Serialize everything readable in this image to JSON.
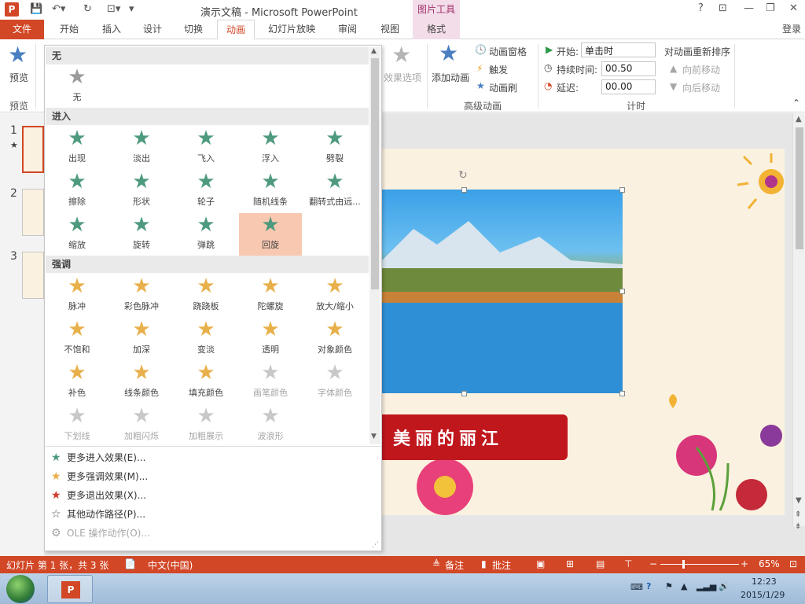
{
  "window": {
    "title": "演示文稿 - Microsoft PowerPoint",
    "context_tab_group": "图片工具",
    "help": "?",
    "login": "登录"
  },
  "tabs": [
    "文件",
    "开始",
    "插入",
    "设计",
    "切换",
    "动画",
    "幻灯片放映",
    "审阅",
    "视图",
    "格式"
  ],
  "active_tab": "动画",
  "ribbon": {
    "preview_label": "预览",
    "preview_group": "预览",
    "effect_options": "效果选项",
    "add_animation": "添加动画",
    "animation_pane": "动画窗格",
    "trigger": "触发",
    "animation_painter": "动画刷",
    "advanced_group": "高级动画",
    "start_label": "开始:",
    "start_value": "单击时",
    "duration_label": "持续时间:",
    "duration_value": "00.50",
    "delay_label": "延迟:",
    "delay_value": "00.00",
    "timing_group": "计时",
    "reorder_title": "对动画重新排序",
    "move_earlier": "向前移动",
    "move_later": "向后移动"
  },
  "gallery": {
    "sections": {
      "none": "无",
      "entrance": "进入",
      "emphasis": "强调"
    },
    "none_items": [
      "无"
    ],
    "entrance_items": [
      "出现",
      "淡出",
      "飞入",
      "浮入",
      "劈裂",
      "擦除",
      "形状",
      "轮子",
      "随机线条",
      "翻转式由远...",
      "缩放",
      "旋转",
      "弹跳",
      "回旋"
    ],
    "emphasis_items": [
      "脉冲",
      "彩色脉冲",
      "跷跷板",
      "陀螺旋",
      "放大/缩小",
      "不饱和",
      "加深",
      "变淡",
      "透明",
      "对象颜色",
      "补色",
      "线条颜色",
      "填充颜色",
      "画笔颜色",
      "字体颜色",
      "下划线",
      "加粗闪烁",
      "加粗展示",
      "波浪形"
    ],
    "selected_item": "回旋",
    "more_links": [
      "更多进入效果(E)...",
      "更多强调效果(M)...",
      "更多退出效果(X)...",
      "其他动作路径(P)...",
      "OLE 操作动作(O)..."
    ]
  },
  "slides": {
    "numbers": [
      "1",
      "2",
      "3"
    ],
    "title_text": "美丽的丽江"
  },
  "status": {
    "slide_info": "幻灯片 第 1 张，共 3 张",
    "language": "中文(中国)",
    "notes": "备注",
    "comments": "批注",
    "zoom": "65%"
  },
  "taskbar": {
    "time": "12:23",
    "date": "2015/1/29"
  },
  "colors": {
    "accent": "#d24726",
    "entrance_star": "#4e9a7e",
    "emphasis_star": "#e8b04a",
    "exit_star": "#d23a2a"
  }
}
